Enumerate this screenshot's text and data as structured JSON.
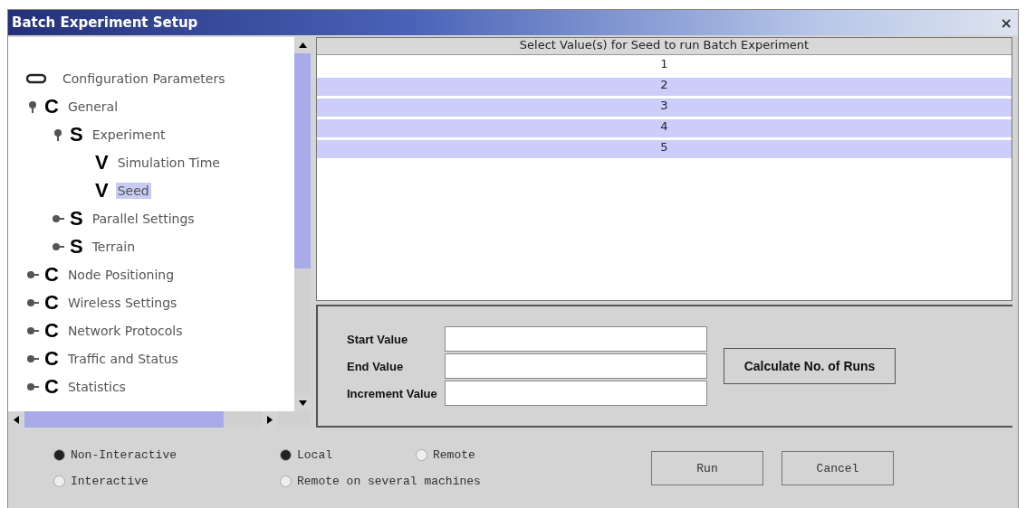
{
  "window": {
    "title": "Batch Experiment Setup",
    "close": "×"
  },
  "tree": {
    "root": "Configuration Parameters",
    "items": [
      {
        "letter": "C",
        "label": "General",
        "expanded": true,
        "selected": false,
        "children": [
          {
            "letter": "S",
            "label": "Experiment",
            "expanded": true,
            "selected": false,
            "children": [
              {
                "letter": "V",
                "label": "Simulation Time",
                "selected": false
              },
              {
                "letter": "V",
                "label": "Seed",
                "selected": true
              }
            ]
          },
          {
            "letter": "S",
            "label": "Parallel Settings",
            "expanded": false,
            "selected": false
          },
          {
            "letter": "S",
            "label": "Terrain",
            "expanded": false,
            "selected": false
          }
        ]
      },
      {
        "letter": "C",
        "label": "Node Positioning",
        "expanded": false,
        "selected": false
      },
      {
        "letter": "C",
        "label": "Wireless Settings",
        "expanded": false,
        "selected": false
      },
      {
        "letter": "C",
        "label": "Network Protocols",
        "expanded": false,
        "selected": false
      },
      {
        "letter": "C",
        "label": "Traffic and Status",
        "expanded": false,
        "selected": false
      },
      {
        "letter": "C",
        "label": "Statistics",
        "expanded": false,
        "selected": false
      }
    ]
  },
  "table": {
    "header": "Select Value(s) for Seed to run Batch Experiment",
    "rows": [
      {
        "value": "1",
        "selected": false
      },
      {
        "value": "2",
        "selected": true
      },
      {
        "value": "3",
        "selected": true
      },
      {
        "value": "4",
        "selected": true
      },
      {
        "value": "5",
        "selected": true
      }
    ]
  },
  "form": {
    "fields": [
      {
        "label": "Start Value"
      },
      {
        "label": "End Value"
      },
      {
        "label": "Increment Value"
      }
    ],
    "calculate": "Calculate No. of Runs"
  },
  "mode": [
    {
      "label": "Non-Interactive",
      "selected": true
    },
    {
      "label": "Interactive",
      "selected": false
    }
  ],
  "location": [
    {
      "label": "Local",
      "selected": true
    },
    {
      "label": "Remote",
      "selected": false
    },
    {
      "label": "Remote on several machines",
      "selected": false
    }
  ],
  "buttons": [
    "Run",
    "Cancel"
  ]
}
